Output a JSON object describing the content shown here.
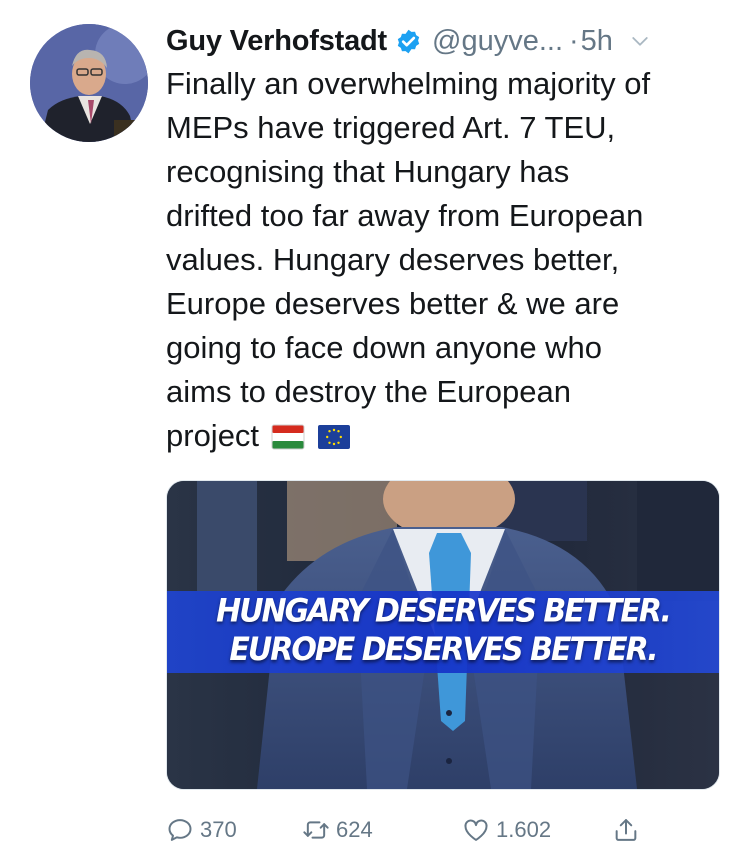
{
  "tweet": {
    "author_name": "Guy Verhofstadt",
    "handle": "@guyve...",
    "separator": "·",
    "time": "5h",
    "text": "Finally an overwhelming majority of\nMEPs have triggered Art. 7 TEU,\nrecognising that Hungary has\ndrifted too far away from European\nvalues. Hungary deserves better,\nEurope deserves better & we are\ngoing to face down anyone who\naims to destroy the European\nproject",
    "flag_icons": [
      "hungary-flag",
      "eu-flag"
    ],
    "media": {
      "line1": "HUNGARY DESERVES BETTER.",
      "line2": "EUROPE DESERVES BETTER."
    },
    "actions": {
      "replies": "370",
      "retweets": "624",
      "likes": "1.602"
    }
  },
  "icons": {
    "verified": "verified-badge-icon",
    "caret": "chevron-down-icon",
    "reply": "reply-icon",
    "retweet": "retweet-icon",
    "like": "heart-icon",
    "share": "share-icon"
  },
  "colors": {
    "verified": "#1da1f2",
    "secondary_text": "#657786",
    "text": "#14171a"
  }
}
